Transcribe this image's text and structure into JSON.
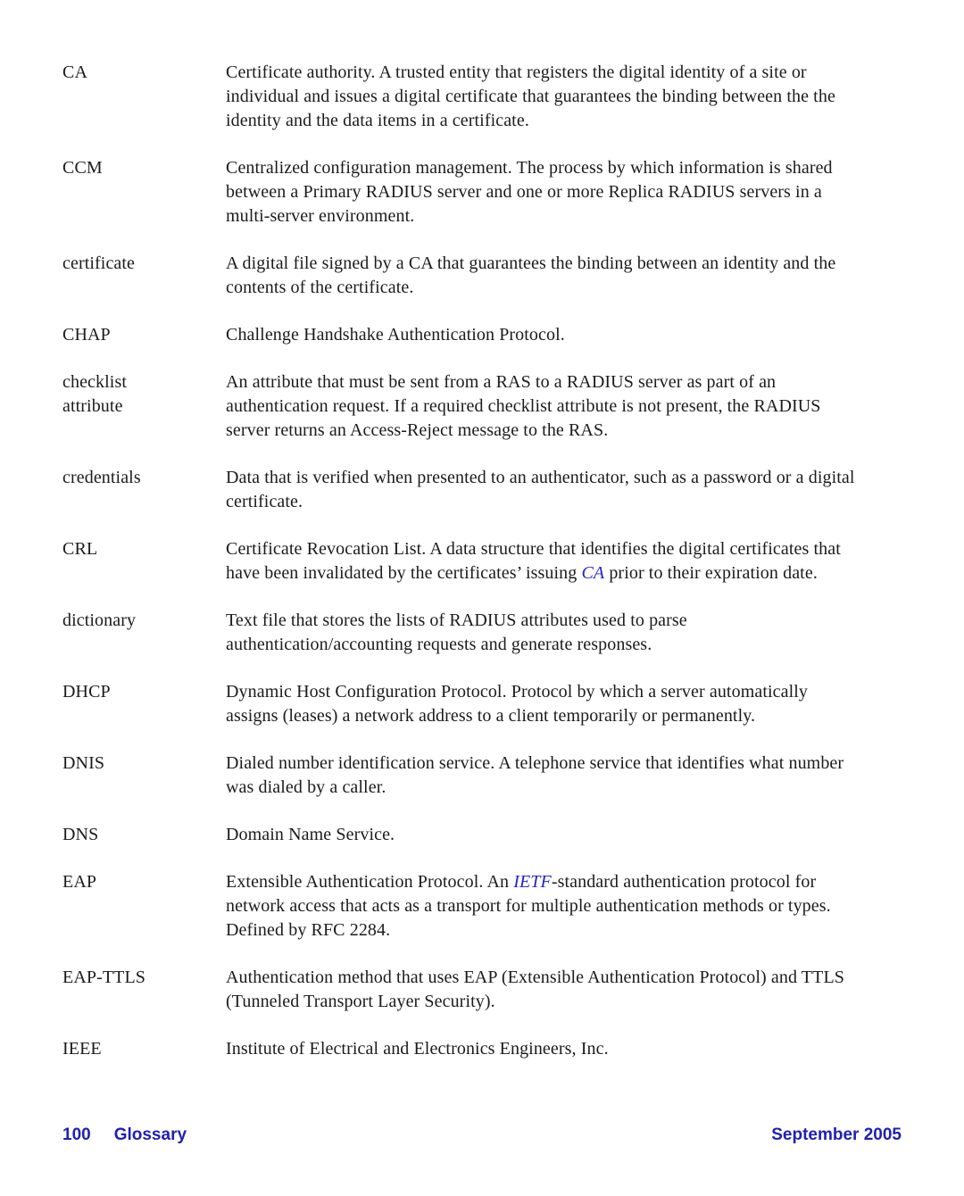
{
  "page": {
    "kind": "glossary-page",
    "background_color": "#ffffff",
    "text_color": "#1b1b1b",
    "link_color": "#2222cc",
    "footer_color": "#1f20b4"
  },
  "glossary": {
    "entries": [
      {
        "term": "CA",
        "definition_parts": [
          {
            "type": "text",
            "text": "Certificate authority. A trusted entity that registers the digital identity of a site or individual and issues a digital certificate that guarantees the binding between the the identity and the data items in a certificate."
          }
        ]
      },
      {
        "term": "CCM",
        "definition_parts": [
          {
            "type": "text",
            "text": "Centralized configuration management. The process by which information is shared between a Primary RADIUS server and one or more Replica RADIUS servers in a multi-server environment."
          }
        ]
      },
      {
        "term": "certificate",
        "definition_parts": [
          {
            "type": "text",
            "text": "A digital file signed by a CA that guarantees the binding between an identity and the contents of the certificate."
          }
        ]
      },
      {
        "term": "CHAP",
        "definition_parts": [
          {
            "type": "text",
            "text": "Challenge Handshake Authentication Protocol."
          }
        ]
      },
      {
        "term": "checklist\nattribute",
        "definition_parts": [
          {
            "type": "text",
            "text": "An attribute that must be sent from a RAS to a RADIUS server as part of an authentication request. If a required checklist attribute is not present, the RADIUS server returns an Access-Reject message to the RAS."
          }
        ]
      },
      {
        "term": "credentials",
        "definition_parts": [
          {
            "type": "text",
            "text": "Data that is verified when presented to an authenticator, such as a password or a digital certificate."
          }
        ]
      },
      {
        "term": "CRL",
        "definition_parts": [
          {
            "type": "text",
            "text": "Certificate Revocation List. A data structure that identifies the digital certificates that have been invalidated by the certificates’ issuing "
          },
          {
            "type": "xref",
            "text": "CA"
          },
          {
            "type": "text",
            "text": " prior to their expiration date."
          }
        ]
      },
      {
        "term": "dictionary",
        "definition_parts": [
          {
            "type": "text",
            "text": "Text file that stores the lists of RADIUS attributes used to parse authentication/accounting requests and generate responses."
          }
        ]
      },
      {
        "term": "DHCP",
        "definition_parts": [
          {
            "type": "text",
            "text": "Dynamic Host Configuration Protocol. Protocol by which a server automatically assigns (leases) a network address to a client temporarily or permanently."
          }
        ]
      },
      {
        "term": "DNIS",
        "definition_parts": [
          {
            "type": "text",
            "text": "Dialed number identification service. A telephone service that identifies what number was dialed by a caller."
          }
        ]
      },
      {
        "term": "DNS",
        "definition_parts": [
          {
            "type": "text",
            "text": "Domain Name Service."
          }
        ]
      },
      {
        "term": "EAP",
        "definition_parts": [
          {
            "type": "text",
            "text": "Extensible Authentication Protocol. An "
          },
          {
            "type": "xref",
            "text": "IETF"
          },
          {
            "type": "text",
            "text": "-standard authentication protocol for network access that acts as a transport for multiple authentication methods or types. Defined by RFC 2284."
          }
        ]
      },
      {
        "term": "EAP-TTLS",
        "definition_parts": [
          {
            "type": "text",
            "text": "Authentication method that uses EAP (Extensible Authentication Protocol) and TTLS (Tunneled Transport Layer Security)."
          }
        ]
      },
      {
        "term": "IEEE",
        "definition_parts": [
          {
            "type": "text",
            "text": "Institute of Electrical and Electronics Engineers, Inc."
          }
        ]
      }
    ]
  },
  "footer": {
    "page_number": "100",
    "section_title": "Glossary",
    "date": "September 2005"
  }
}
